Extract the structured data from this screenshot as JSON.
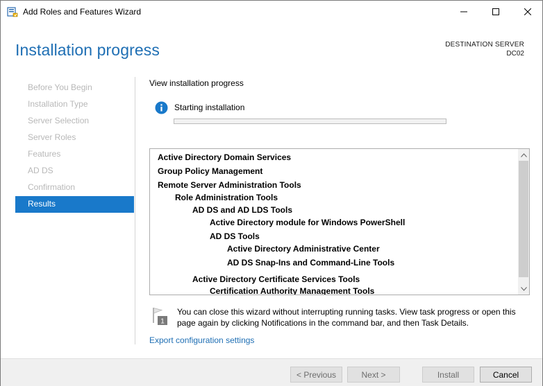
{
  "window": {
    "title": "Add Roles and Features Wizard"
  },
  "header": {
    "page_title": "Installation progress",
    "destination_label": "DESTINATION SERVER",
    "destination_server": "DC02"
  },
  "nav": {
    "items": [
      {
        "label": "Before You Begin",
        "active": false
      },
      {
        "label": "Installation Type",
        "active": false
      },
      {
        "label": "Server Selection",
        "active": false
      },
      {
        "label": "Server Roles",
        "active": false
      },
      {
        "label": "Features",
        "active": false
      },
      {
        "label": "AD DS",
        "active": false
      },
      {
        "label": "Confirmation",
        "active": false
      },
      {
        "label": "Results",
        "active": true
      }
    ]
  },
  "main": {
    "view_label": "View installation progress",
    "status": "Starting installation",
    "progress_percent": 0,
    "features": [
      {
        "label": "Active Directory Domain Services",
        "level": 0
      },
      {
        "label": "Group Policy Management",
        "level": 0
      },
      {
        "label": "Remote Server Administration Tools",
        "level": 0
      },
      {
        "label": "Role Administration Tools",
        "level": 1
      },
      {
        "label": "AD DS and AD LDS Tools",
        "level": 2
      },
      {
        "label": "Active Directory module for Windows PowerShell",
        "level": 3
      },
      {
        "label": "AD DS Tools",
        "level": 3
      },
      {
        "label": "Active Directory Administrative Center",
        "level": 4
      },
      {
        "label": "AD DS Snap-Ins and Command-Line Tools",
        "level": 4
      },
      {
        "label": "Active Directory Certificate Services Tools",
        "level": 2
      },
      {
        "label": "Certification Authority Management Tools",
        "level": 3
      }
    ],
    "note": "You can close this wizard without interrupting running tasks. View task progress or open this page again by clicking Notifications in the command bar, and then Task Details.",
    "notification_count": "1",
    "export_link": "Export configuration settings"
  },
  "footer": {
    "previous_label": "< Previous",
    "next_label": "Next >",
    "install_label": "Install",
    "cancel_label": "Cancel"
  },
  "colors": {
    "accent": "#1979ca",
    "title_blue": "#1f6fb4",
    "progress_green": "#06b025"
  }
}
